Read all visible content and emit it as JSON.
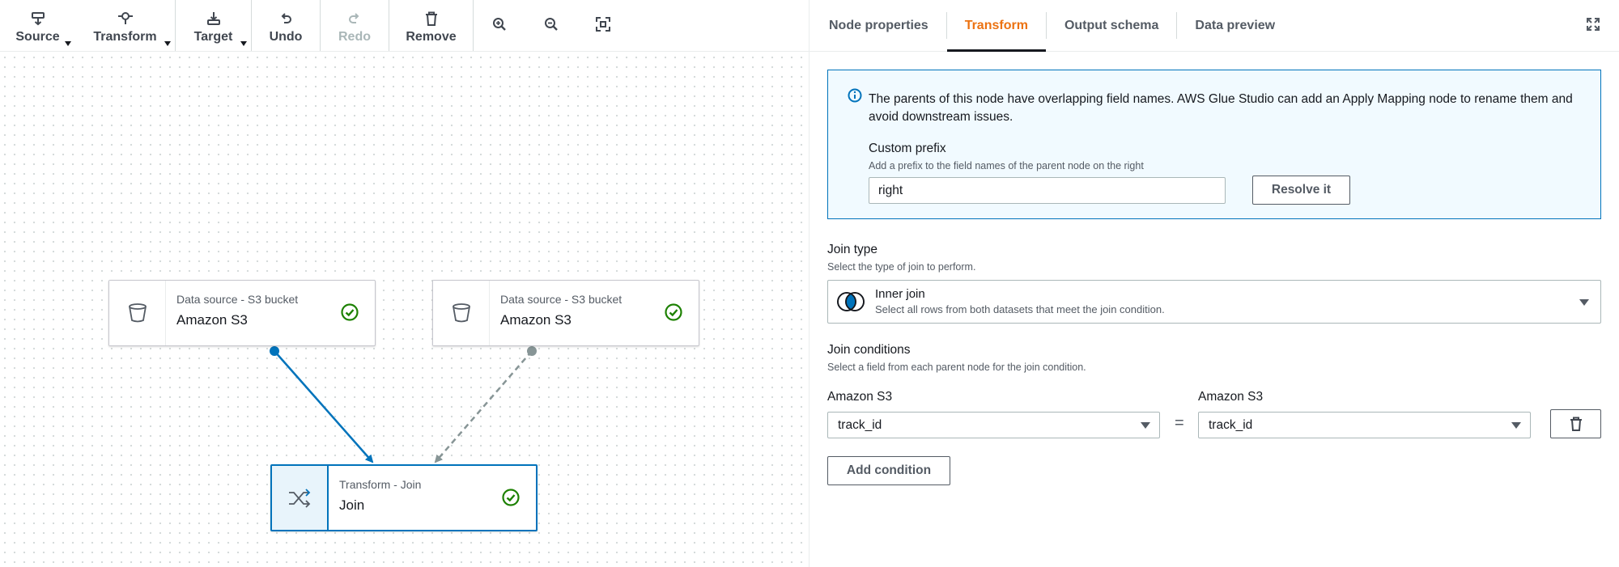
{
  "toolbar": {
    "source_label": "Source",
    "transform_label": "Transform",
    "target_label": "Target",
    "undo_label": "Undo",
    "redo_label": "Redo",
    "remove_label": "Remove",
    "icons": [
      "source-icon",
      "transform-icon",
      "target-icon",
      "undo-icon",
      "redo-icon",
      "trash-icon",
      "zoom-in-icon",
      "zoom-out-icon",
      "fit-to-screen-icon"
    ]
  },
  "canvas": {
    "nodes": [
      {
        "subtitle": "Data source - S3 bucket",
        "title": "Amazon S3",
        "icon": "bucket-icon",
        "status": "success-check-icon"
      },
      {
        "subtitle": "Data source - S3 bucket",
        "title": "Amazon S3",
        "icon": "bucket-icon",
        "status": "success-check-icon"
      },
      {
        "subtitle": "Transform - Join",
        "title": "Join",
        "icon": "shuffle-icon",
        "status": "success-check-icon",
        "selected": true
      }
    ]
  },
  "tabs": [
    {
      "label": "Node properties",
      "active": false
    },
    {
      "label": "Transform",
      "active": true
    },
    {
      "label": "Output schema",
      "active": false
    },
    {
      "label": "Data preview",
      "active": false
    }
  ],
  "info": {
    "message": "The parents of this node have overlapping field names. AWS Glue Studio can add an Apply Mapping node to rename them and avoid downstream issues.",
    "prefix_label": "Custom prefix",
    "prefix_description": "Add a prefix to the field names of the parent node on the right",
    "prefix_value": "right",
    "resolve_label": "Resolve it"
  },
  "join": {
    "type_label": "Join type",
    "type_description": "Select the type of join to perform.",
    "selected_label": "Inner join",
    "selected_description": "Select all rows from both datasets that meet the join condition.",
    "conditions_label": "Join conditions",
    "conditions_description": "Select a field from each parent node for the join condition.",
    "left_parent_label": "Amazon S3",
    "right_parent_label": "Amazon S3",
    "left_field": "track_id",
    "right_field": "track_id",
    "operator": "=",
    "add_condition_label": "Add condition"
  },
  "colors": {
    "accent": "#ec7211",
    "selected_edge": "#0073bb",
    "success": "#1d8102",
    "info_bg": "#f1faff"
  }
}
